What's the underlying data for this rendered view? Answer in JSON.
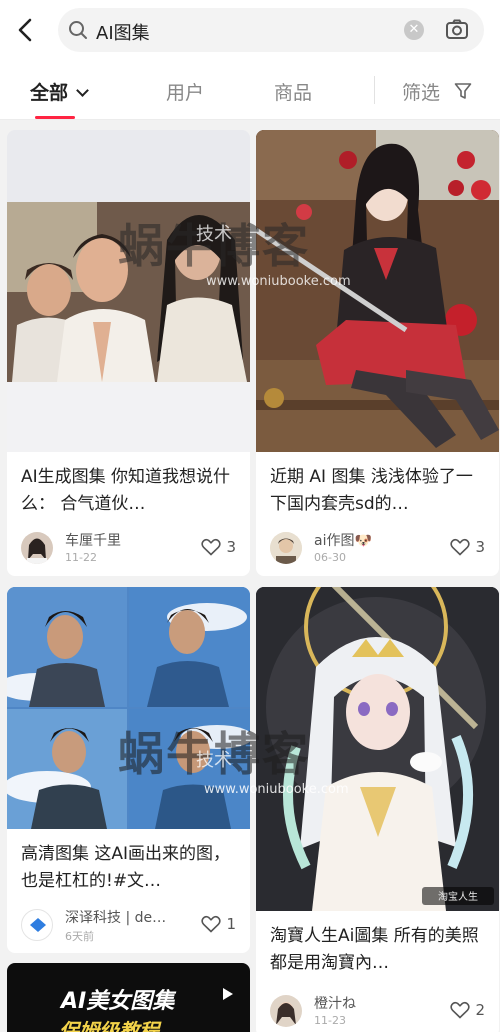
{
  "search": {
    "query": "AI图集"
  },
  "tabs": [
    {
      "label": "全部"
    },
    {
      "label": "用户"
    },
    {
      "label": "商品"
    },
    {
      "label": "筛选"
    }
  ],
  "cards": [
    {
      "title": "AI生成图集 你知道我想说什么： 合气道伙…",
      "author": "车厘千里",
      "date": "11-22",
      "likes": "3"
    },
    {
      "title": "近期 AI 图集 浅浅体验了一下国内套壳sd的…",
      "author": "ai作图🐶",
      "date": "06-30",
      "likes": "3"
    },
    {
      "title": "高清图集 这AI画出来的图，也是杠杠的!#文…",
      "author": "深译科技 | de…",
      "date": "6天前",
      "likes": "1"
    },
    {
      "title": "淘寶人生Ai圖集 所有的美照都是用淘寶內…",
      "author": "橙汁ね",
      "date": "11-23",
      "likes": "2"
    },
    {
      "title": "AI美女图集",
      "subtitle": "保姆级教程"
    }
  ],
  "watermark": {
    "text": "蜗牛博客",
    "sub": "技术",
    "url": "www.woniubooke.com"
  },
  "image_caption": "淘宝人生",
  "colors": {
    "accent": "#ff2442",
    "background": "#f2f2f2"
  }
}
